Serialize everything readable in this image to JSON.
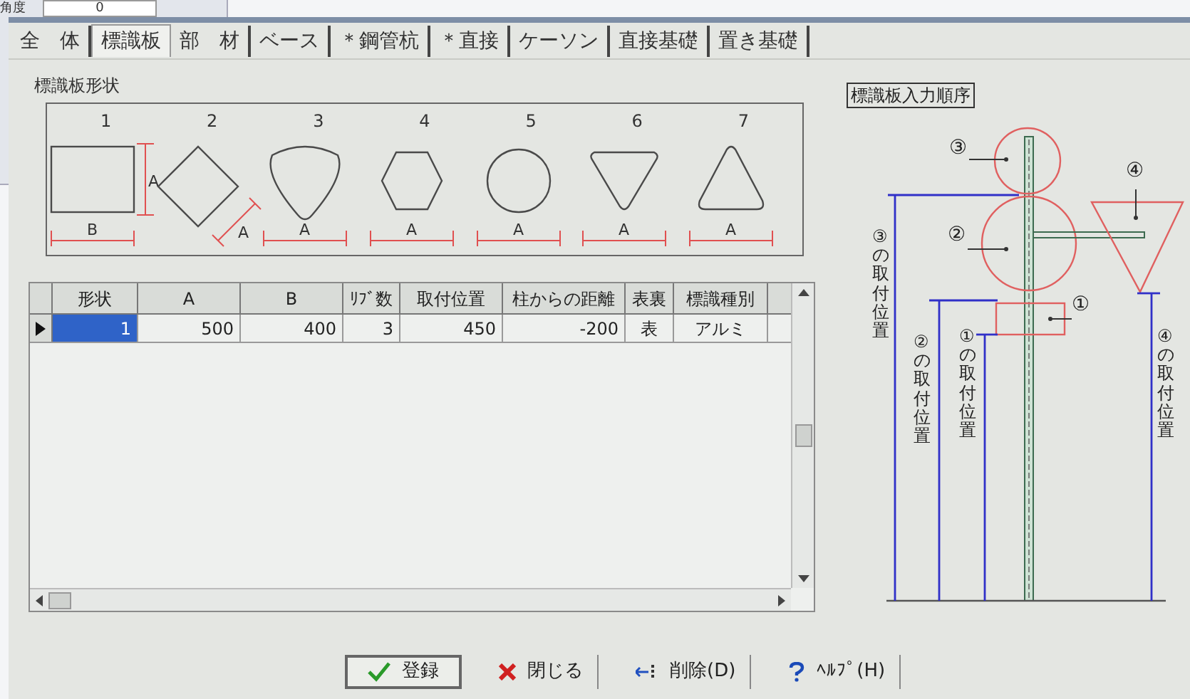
{
  "background_window": {
    "label": "角度",
    "value": "0"
  },
  "tabs": [
    {
      "label": "全　体",
      "selected": false
    },
    {
      "label": "標識板",
      "selected": true
    },
    {
      "label": "部　材",
      "selected": false
    },
    {
      "label": "ベース",
      "selected": false
    },
    {
      "label": "＊鋼管杭",
      "selected": false
    },
    {
      "label": "＊直接",
      "selected": false
    },
    {
      "label": "ケーソン",
      "selected": false
    },
    {
      "label": "直接基礎",
      "selected": false
    },
    {
      "label": "置き基礎",
      "selected": false
    }
  ],
  "shape_group": {
    "title": "標識板形状",
    "shapes": [
      {
        "number": "1",
        "kind": "rectangle",
        "width_label": "B",
        "height_label": "A"
      },
      {
        "number": "2",
        "kind": "diamond",
        "width_label": "A"
      },
      {
        "number": "3",
        "kind": "rounded-triangle",
        "width_label": "A"
      },
      {
        "number": "4",
        "kind": "hexagon",
        "width_label": "A"
      },
      {
        "number": "5",
        "kind": "circle",
        "width_label": "A"
      },
      {
        "number": "6",
        "kind": "inverted-triangle",
        "width_label": "A"
      },
      {
        "number": "7",
        "kind": "triangle",
        "width_label": "A"
      }
    ]
  },
  "table": {
    "columns": [
      "形状",
      "A",
      "B",
      "ﾘﾌﾞ数",
      "取付位置",
      "柱からの距離",
      "表裏",
      "標識種別"
    ],
    "rows": [
      {
        "selected": true,
        "cells": [
          "1",
          "500",
          "400",
          "3",
          "450",
          "-200",
          "表",
          "アルミ"
        ]
      }
    ]
  },
  "diagram": {
    "title": "標識板入力順序",
    "markers": [
      "③",
      "②",
      "①",
      "④"
    ],
    "position_labels": [
      "③の取付位置",
      "②の取付位置",
      "①の取付位置",
      "④の取付位置"
    ]
  },
  "buttons": [
    {
      "kind": "register",
      "label": "登録",
      "default": true
    },
    {
      "kind": "close",
      "label": "閉じる",
      "default": false
    },
    {
      "kind": "delete",
      "label": "削除(D)",
      "default": false
    },
    {
      "kind": "help",
      "label": "ﾍﾙﾌﾟ(H)",
      "default": false
    }
  ]
}
